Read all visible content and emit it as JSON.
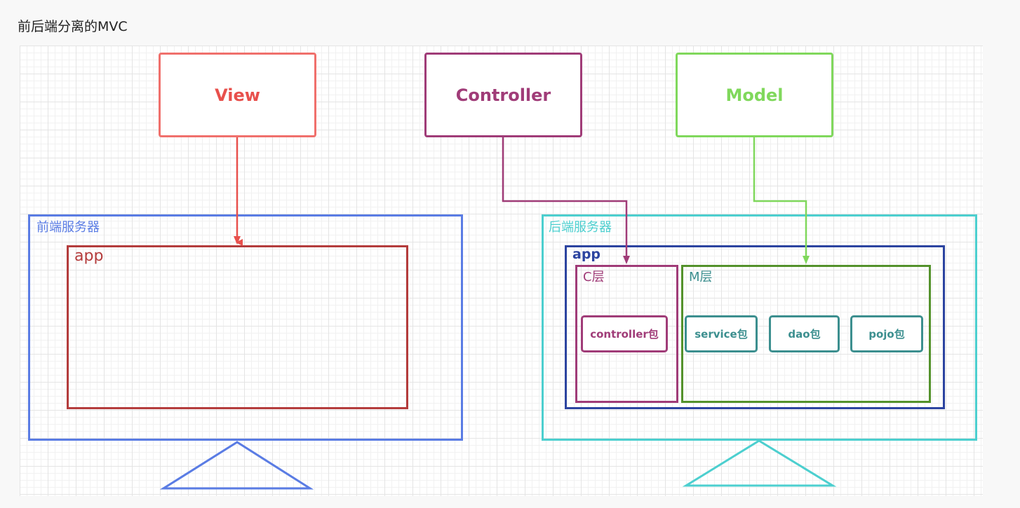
{
  "page": {
    "title": "前后端分离的MVC"
  },
  "diagram": {
    "top": {
      "view": "View",
      "controller": "Controller",
      "model": "Model"
    },
    "frontend": {
      "server_label": "前端服务器",
      "app_label": "app"
    },
    "backend": {
      "server_label": "后端服务器",
      "app_label": "app",
      "c_layer": {
        "label": "C层",
        "packages": [
          "controller包"
        ]
      },
      "m_layer": {
        "label": "M层",
        "packages": [
          "service包",
          "dao包",
          "pojo包"
        ]
      }
    }
  },
  "colors": {
    "view": "#f0706c",
    "view_text": "#e8504c",
    "controller": "#a03c78",
    "model": "#80d85c",
    "frontend_server": "#5a7ce4",
    "frontend_app": "#b43c3c",
    "backend_server": "#4ccfcf",
    "backend_app": "#2c44a0",
    "c_layer": "#a03c78",
    "m_layer": "#54922c",
    "package": "#3c8f8f"
  }
}
